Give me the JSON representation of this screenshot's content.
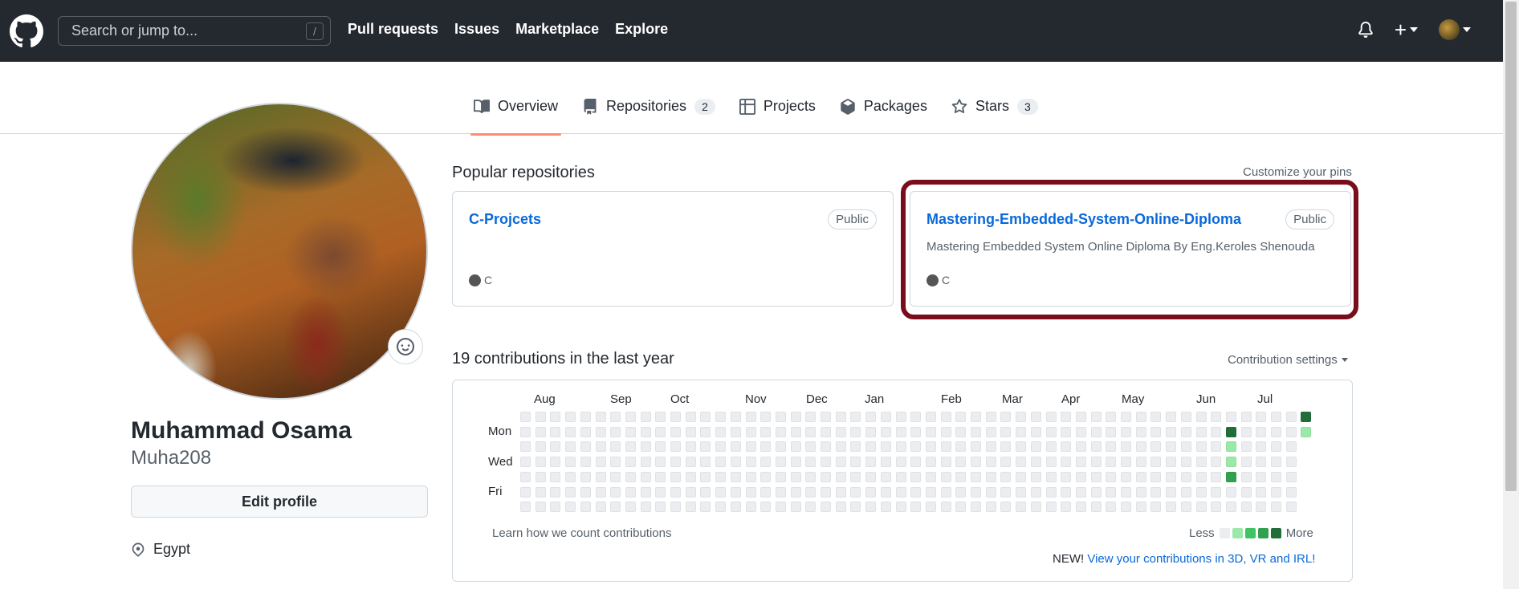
{
  "header": {
    "search_placeholder": "Search or jump to...",
    "search_shortcut": "/",
    "nav": [
      "Pull requests",
      "Issues",
      "Marketplace",
      "Explore"
    ],
    "plus": "+"
  },
  "tabs": [
    {
      "label": "Overview",
      "count": null,
      "icon": "book-icon",
      "active": true
    },
    {
      "label": "Repositories",
      "count": "2",
      "icon": "repo-icon"
    },
    {
      "label": "Projects",
      "count": null,
      "icon": "table-icon"
    },
    {
      "label": "Packages",
      "count": null,
      "icon": "package-icon"
    },
    {
      "label": "Stars",
      "count": "3",
      "icon": "star-icon"
    }
  ],
  "profile": {
    "name": "Muhammad Osama",
    "username": "Muha208",
    "edit_label": "Edit profile",
    "location": "Egypt"
  },
  "popular": {
    "title": "Popular repositories",
    "customize": "Customize your pins",
    "repos": [
      {
        "name": "C-Projcets",
        "visibility": "Public",
        "description": "",
        "language": "C",
        "lang_color": "#555555"
      },
      {
        "name": "Mastering-Embedded-System-Online-Diploma",
        "visibility": "Public",
        "description": "Mastering Embedded System Online Diploma By Eng.Keroles Shenouda",
        "language": "C",
        "lang_color": "#555555"
      }
    ]
  },
  "contributions": {
    "title": "19 contributions in the last year",
    "settings": "Contribution settings",
    "months": [
      "Aug",
      "Sep",
      "Oct",
      "Nov",
      "Dec",
      "Jan",
      "Feb",
      "Mar",
      "Apr",
      "May",
      "Jun",
      "Jul"
    ],
    "day_labels": [
      "Mon",
      "Wed",
      "Fri"
    ],
    "learn": "Learn how we count contributions",
    "less": "Less",
    "more": "More",
    "new_prefix": "NEW!",
    "new_link": "View your contributions in 3D, VR and IRL!",
    "colors": [
      "#ebedf0",
      "#9be9a8",
      "#40c463",
      "#30a14e",
      "#216e39"
    ]
  }
}
